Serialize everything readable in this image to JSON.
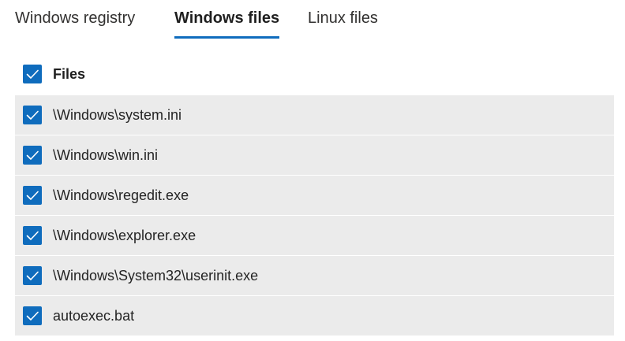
{
  "tabs": [
    {
      "label": "Windows registry",
      "active": false
    },
    {
      "label": "Windows files",
      "active": true
    },
    {
      "label": "Linux files",
      "active": false
    }
  ],
  "header": {
    "label": "Files",
    "checked": true
  },
  "files": [
    {
      "path": "\\Windows\\system.ini",
      "checked": true
    },
    {
      "path": "\\Windows\\win.ini",
      "checked": true
    },
    {
      "path": "\\Windows\\regedit.exe",
      "checked": true
    },
    {
      "path": "\\Windows\\explorer.exe",
      "checked": true
    },
    {
      "path": "\\Windows\\System32\\userinit.exe",
      "checked": true
    },
    {
      "path": "autoexec.bat",
      "checked": true
    }
  ],
  "colors": {
    "accent": "#0f6cbd",
    "row_background": "#ebebeb"
  },
  "icons": {
    "checkbox": "checkmark-icon"
  }
}
